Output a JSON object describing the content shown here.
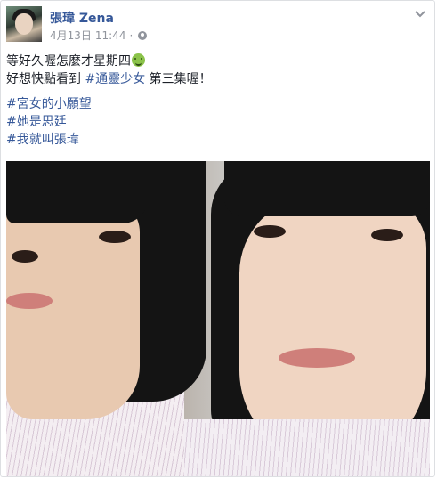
{
  "post": {
    "author": "張瑋 Zena",
    "date": "4月13日",
    "time": "11:44",
    "separator": "·",
    "privacy_icon": "globe-icon",
    "menu_icon": "chevron-down-icon",
    "text": {
      "line1": "等好久喔怎麼才星期四",
      "line1_emoji": "nauseated-face-emoji",
      "line2_prefix": "好想快點看到 ",
      "line2_hashtag": "#通靈少女",
      "line2_suffix": " 第三集喔！"
    },
    "hashtags": [
      "#宮女的小願望",
      "#她是思廷",
      "#我就叫張瑋"
    ]
  },
  "colors": {
    "link": "#365899",
    "meta": "#90949c",
    "text": "#1d2129",
    "border": "#dddfe2"
  }
}
